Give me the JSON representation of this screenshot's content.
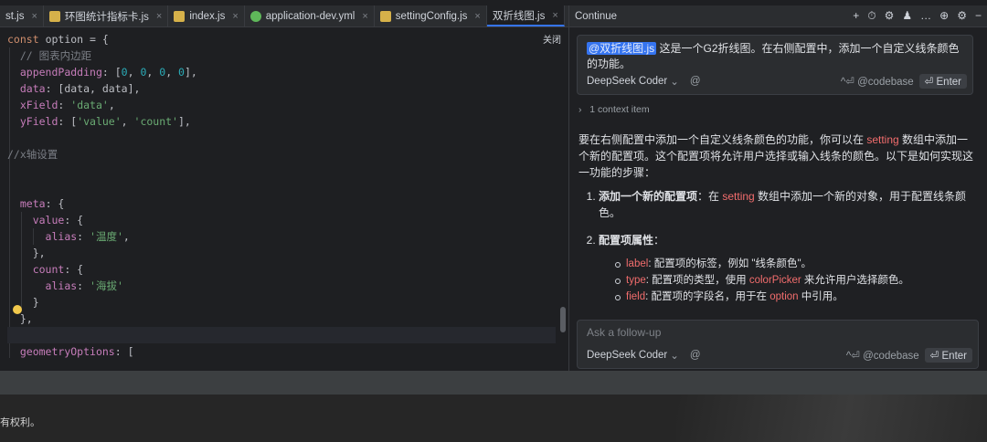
{
  "tabs": [
    {
      "label": "st.js",
      "icon": "js-file-icon"
    },
    {
      "label": "环图统计指标卡.js",
      "icon": "js-file-icon"
    },
    {
      "label": "index.js",
      "icon": "js-file-icon"
    },
    {
      "label": "application-dev.yml",
      "icon": "yml-file-icon"
    },
    {
      "label": "settingConfig.js",
      "icon": "js-file-icon"
    },
    {
      "label": "双折线图.js",
      "icon": "js-file-icon"
    }
  ],
  "editor": {
    "close_label": "关闭",
    "lines": [
      "const option = {",
      "  // 图表内边距",
      "  appendPadding: [0, 0, 0, 0],",
      "  data: [data, data],",
      "  xField: 'data',",
      "  yField: ['value', 'count'],",
      "",
      "//x轴设置",
      "",
      "",
      "  meta: {",
      "    value: {",
      "      alias: '温度',",
      "    },",
      "    count: {",
      "      alias: '海拔'",
      "    }",
      "  },",
      "",
      "  geometryOptions: ["
    ]
  },
  "panel": {
    "title": "Continue",
    "actions": [
      "+",
      "⏱",
      "⚙",
      "♟",
      "…",
      "⊕",
      "⚙",
      "−"
    ],
    "user_mention": "@双折线图.js",
    "user_text": " 这是一个G2折线图。在右侧配置中，添加一个自定义线条颜色的功能。",
    "model": "DeepSeek Coder",
    "at_symbol": "@",
    "shortcut": "^⏎ @codebase",
    "enter_label": "⏎ Enter",
    "context": "1 context item",
    "answer": {
      "intro_1": "要在右侧配置中添加一个自定义线条颜色的功能，你可以在 ",
      "intro_hl": "setting",
      "intro_2": " 数组中添加一个新的配置项。这个配置项将允许用户选择或输入线条的颜色。以下是如何实现这一功能的步骤：",
      "step1_title": "添加一个新的配置项",
      "step1_a": "：在 ",
      "step1_hl": "setting",
      "step1_b": " 数组中添加一个新的对象，用于配置线条颜色。",
      "step2_title": "配置项属性",
      "step2_colon": "：",
      "bullets": [
        {
          "key": "label",
          "text": ": 配置项的标签，例如 \"线条颜色\"。"
        },
        {
          "key": "type",
          "text_a": ": 配置项的类型，使用 ",
          "hl": "colorPicker",
          "text_b": " 来允许用户选择颜色。"
        },
        {
          "key": "field",
          "text_a": ": 配置项的字段名，用于在 ",
          "hl": "option",
          "text_b": " 中引用。"
        }
      ]
    },
    "input_placeholder": "Ask a follow-up"
  },
  "bottom_text": "有权利。"
}
